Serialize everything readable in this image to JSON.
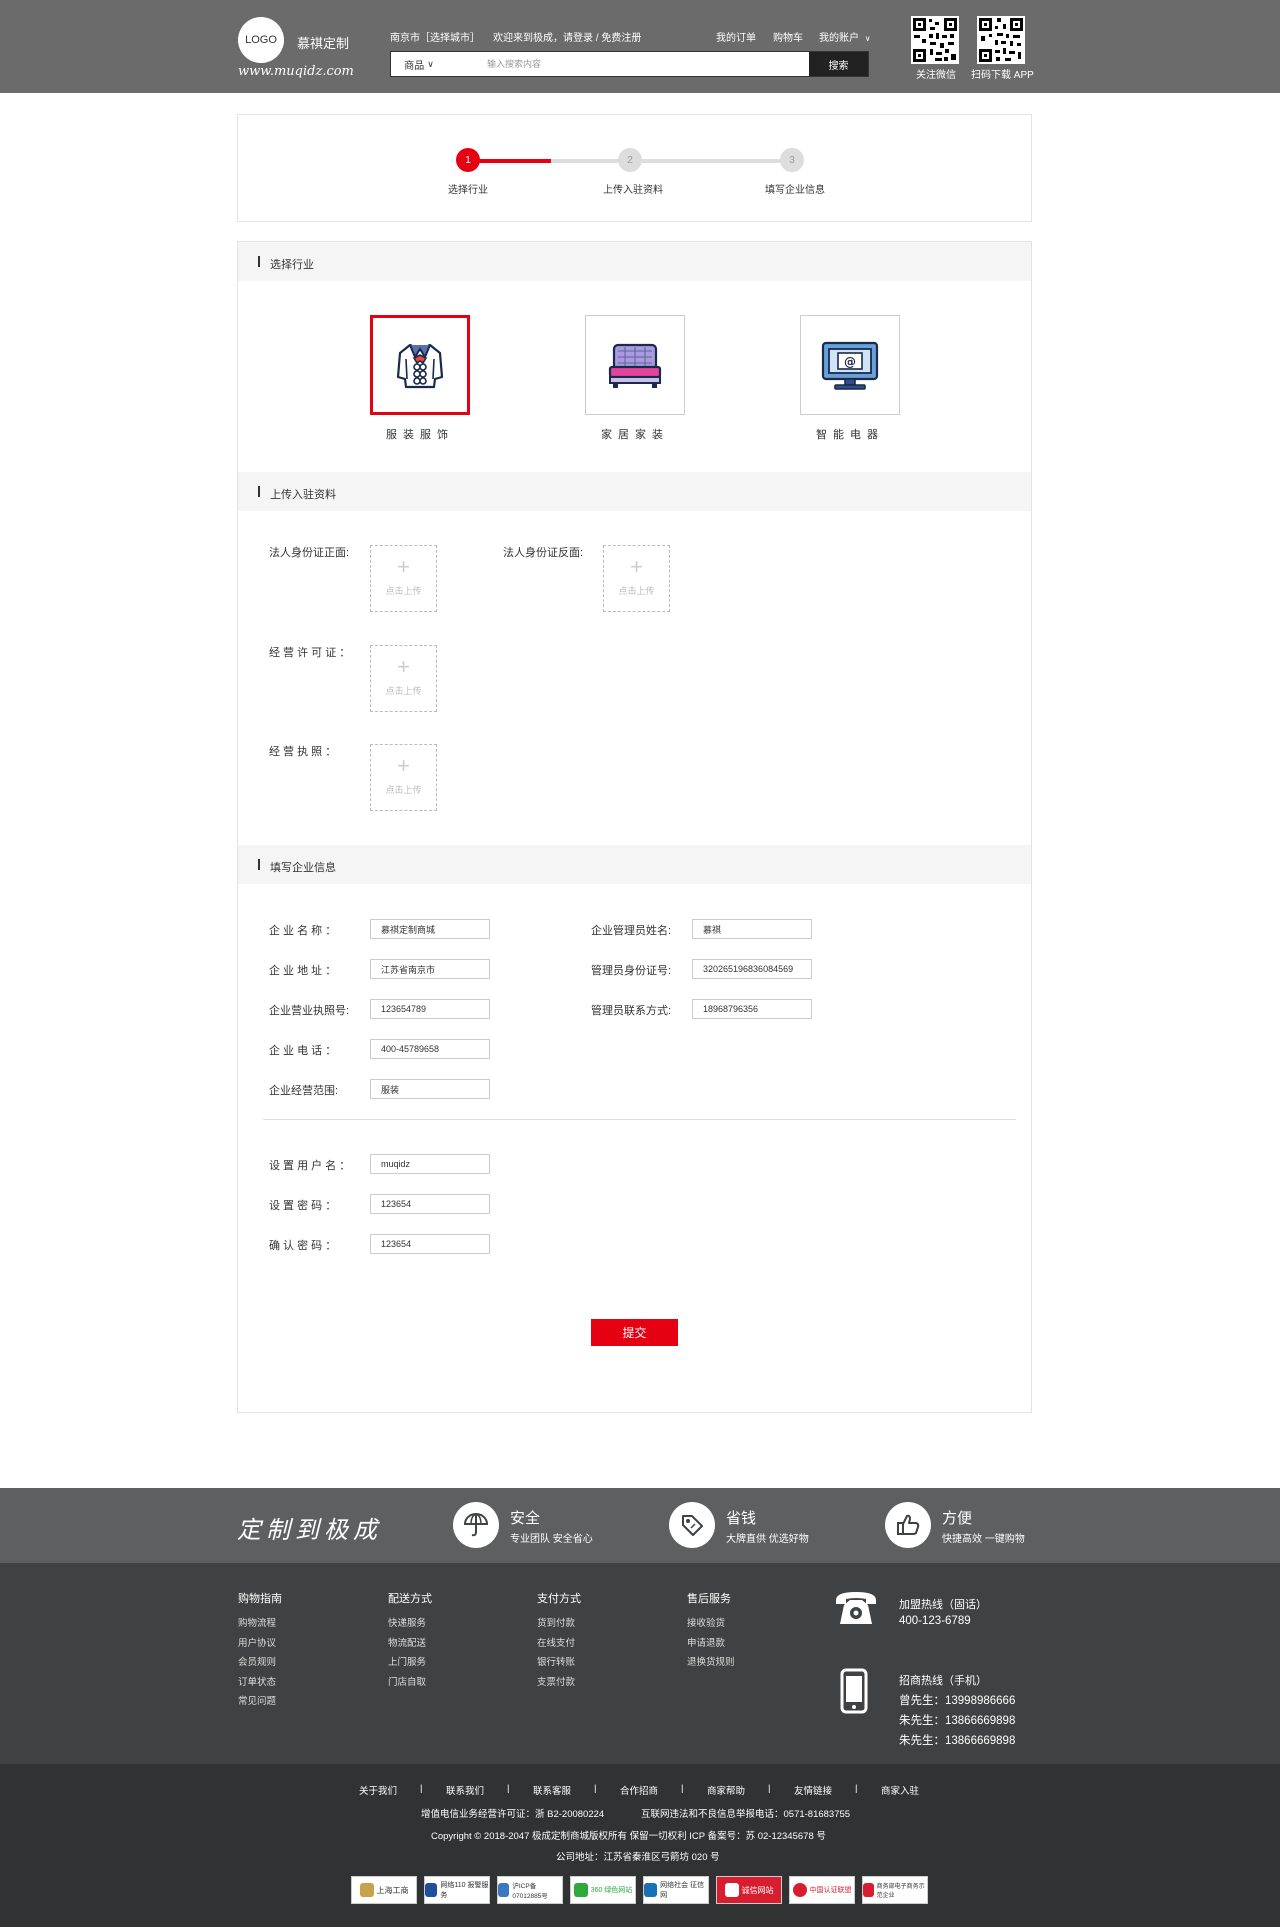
{
  "header": {
    "logo_text": "LOGO",
    "brand_name": "慕祺定制",
    "brand_url": "www.muqidz.com",
    "city": "南京市［选择城市］",
    "welcome": "欢迎来到极成，请登录 / 免费注册",
    "nav": {
      "orders": "我的订单",
      "cart": "购物车",
      "account": "我的账户"
    },
    "search": {
      "category": "商品",
      "placeholder": "输入搜索内容",
      "button": "搜索"
    },
    "qr": {
      "wechat": "关注微信",
      "app": "扫码下载 APP"
    }
  },
  "steps": [
    {
      "num": "1",
      "label": "选择行业",
      "state": "active"
    },
    {
      "num": "2",
      "label": "上传入驻资料",
      "state": "inactive"
    },
    {
      "num": "3",
      "label": "填写企业信息",
      "state": "inactive"
    }
  ],
  "progress": 0.5,
  "sections": {
    "industry": "选择行业",
    "upload": "上传入驻资料",
    "company": "填写企业信息"
  },
  "industries": [
    {
      "label": "服装服饰",
      "icon": "clothing-icon",
      "selected": true
    },
    {
      "label": "家居家装",
      "icon": "bed-icon",
      "selected": false
    },
    {
      "label": "智能电器",
      "icon": "computer-monitor-icon",
      "selected": false
    }
  ],
  "uploads": {
    "id_front": "法人身份证正面:",
    "id_back": "法人身份证反面:",
    "license": "经 营 许 可 证 ：",
    "business": "经   营   执   照  ：",
    "plus": "+",
    "click_upload": "点击上传"
  },
  "company_form": {
    "name_label": "企 业 名 称 ：",
    "name_value": "慕祺定制商城",
    "address_label": "企 业 地 址 ：",
    "address_value": "江苏省南京市",
    "license_no_label": "企业营业执照号:",
    "license_no_value": "123654789",
    "phone_label": "企 业 电 话 ：",
    "phone_value": "400-45789658",
    "scope_label": "企业经营范围:",
    "scope_value": "服装",
    "admin_name_label": "企业管理员姓名:",
    "admin_name_value": "慕祺",
    "admin_id_label": "管理员身份证号:",
    "admin_id_value": "320265196836084569",
    "admin_contact_label": "管理员联系方式:",
    "admin_contact_value": "18968796356"
  },
  "account_form": {
    "username_label": "设 置 用 户 名 ：",
    "username_value": "muqidz",
    "password_label": "设   置   密   码  ：",
    "password_value": "123654",
    "confirm_label": "确   认   密   码  ：",
    "confirm_value": "123654"
  },
  "submit": "提交",
  "footer": {
    "slogan": "定制到极成",
    "features": [
      {
        "title": "安全",
        "desc": "专业团队 安全省心",
        "icon": "umbrella-icon"
      },
      {
        "title": "省钱",
        "desc": "大牌直供 优选好物",
        "icon": "price-tag-icon"
      },
      {
        "title": "方便",
        "desc": "快捷高效 一键购物",
        "icon": "thumbs-up-icon"
      }
    ],
    "columns": [
      {
        "title": "购物指南",
        "items": [
          "购物流程",
          "用户协议",
          "会员规则",
          "订单状态",
          "常见问题"
        ]
      },
      {
        "title": "配送方式",
        "items": [
          "快递服务",
          "物流配送",
          "上门服务",
          "门店自取"
        ]
      },
      {
        "title": "支付方式",
        "items": [
          "货到付款",
          "在线支付",
          "银行转账",
          "支票付款"
        ]
      },
      {
        "title": "售后服务",
        "items": [
          "接收验货",
          "申请退款",
          "退换货规则"
        ]
      }
    ],
    "hotline": {
      "landline_label": "加盟热线（固话）",
      "landline": "400-123-6789",
      "mobile_label": "招商热线（手机）",
      "mobiles": [
        "曾先生：13998986666",
        "朱先生：13866669898",
        "朱先生：13866669898"
      ]
    },
    "links": [
      "关于我们",
      "联系我们",
      "联系客服",
      "合作招商",
      "商家帮助",
      "友情链接",
      "商家入驻"
    ],
    "sep": "|",
    "license_line": "增值电信业务经营许可证：浙 B2-20080224",
    "report_line": "互联网违法和不良信息举报电话：0571-81683755",
    "copyright": "Copyright © 2018-2047 极成定制商城版权所有 保留一切权利 ICP 备案号：苏 02-12345678 号",
    "address": "公司地址：江苏省秦淮区弓箭坊 020 号",
    "badges": [
      "上海工商",
      "网络110 报警服务",
      "沪ICP备 07012885号",
      "360 绿色网站",
      "网络社会 征信网",
      "诚信网站",
      "中国认证联盟",
      "商务部电子商务示范企业"
    ]
  }
}
